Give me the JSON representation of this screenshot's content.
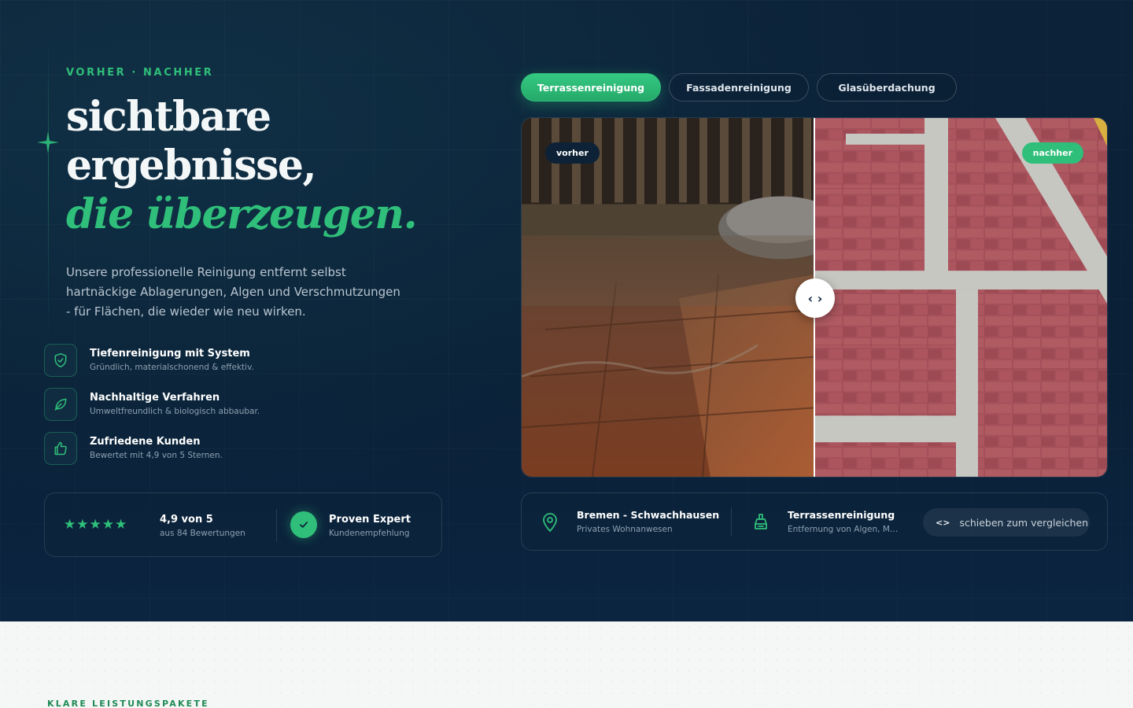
{
  "hero": {
    "eyebrow": "VORHER · NACHHER",
    "headline_line1": "sichtbare",
    "headline_line2": "ergebnisse,",
    "headline_accent": "die überzeugen.",
    "lead": "Unsere professionelle Reinigung entfernt selbst hartnäckige Ablagerungen, Algen und Verschmutzungen - für Flächen, die wieder wie neu wirken."
  },
  "features": [
    {
      "icon": "shield-check-icon",
      "title": "Tiefenreinigung mit System",
      "subtitle": "Gründlich, materialschonend & effektiv."
    },
    {
      "icon": "leaf-icon",
      "title": "Nachhaltige Verfahren",
      "subtitle": "Umweltfreundlich & biologisch abbaubar."
    },
    {
      "icon": "thumbs-up-icon",
      "title": "Zufriedene Kunden",
      "subtitle": "Bewertet mit 4,9 von 5 Sternen."
    }
  ],
  "rating": {
    "stars": "★★★★★",
    "value": "4,9 von 5",
    "count": "aus 84 Bewertungen",
    "badge_title": "Proven Expert",
    "badge_sub": "Kundenempfehlung"
  },
  "tabs": [
    {
      "label": "Terrassenreinigung",
      "active": true
    },
    {
      "label": "Fassadenreinigung",
      "active": false
    },
    {
      "label": "Glasüberdachung",
      "active": false
    }
  ],
  "compare": {
    "before_label": "vorher",
    "after_label": "nachher",
    "handle_glyph": "‹ ›"
  },
  "info": {
    "location_title": "Bremen - Schwachhausen",
    "location_sub": "Privates Wohnanwesen",
    "service_title": "Terrassenreinigung",
    "service_sub": "Entfernung von Algen, Moos und Schmutz",
    "slide_code": "<>",
    "slide_label": "schieben zum vergleichen"
  },
  "lower": {
    "eyebrow": "KLARE LEISTUNGSPAKETE"
  },
  "colors": {
    "accent": "#2fbf7a",
    "background": "#0b2238",
    "lower_bg": "#f5f7f6"
  }
}
